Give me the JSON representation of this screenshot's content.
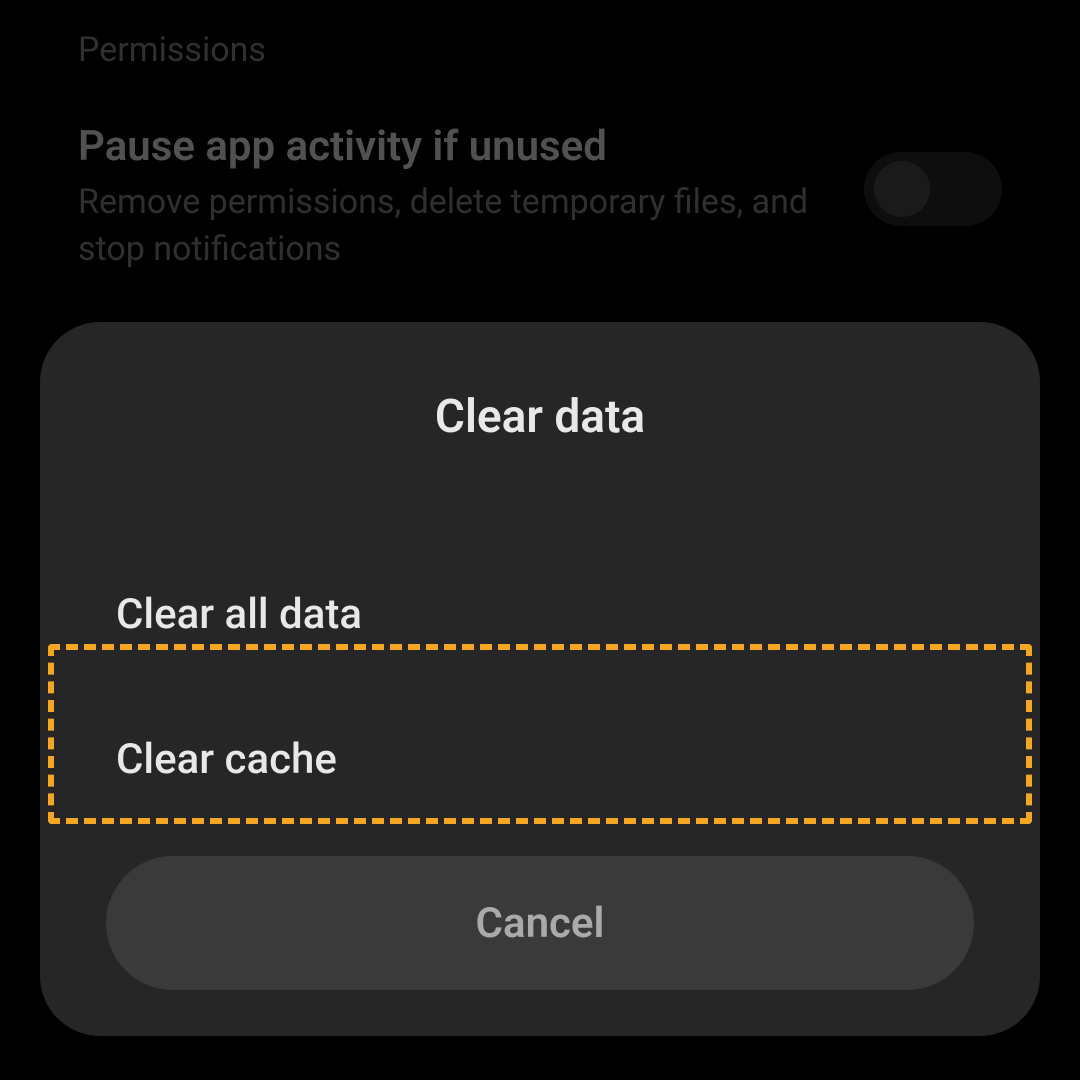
{
  "background": {
    "permissions_label": "Permissions",
    "pause_activity": {
      "title": "Pause app activity if unused",
      "description": "Remove permissions, delete temporary files, and stop notifications"
    }
  },
  "dialog": {
    "title": "Clear data",
    "options": {
      "clear_all_data": "Clear all data",
      "clear_cache": "Clear cache"
    },
    "cancel_label": "Cancel"
  },
  "highlight_color": "#f5a623"
}
